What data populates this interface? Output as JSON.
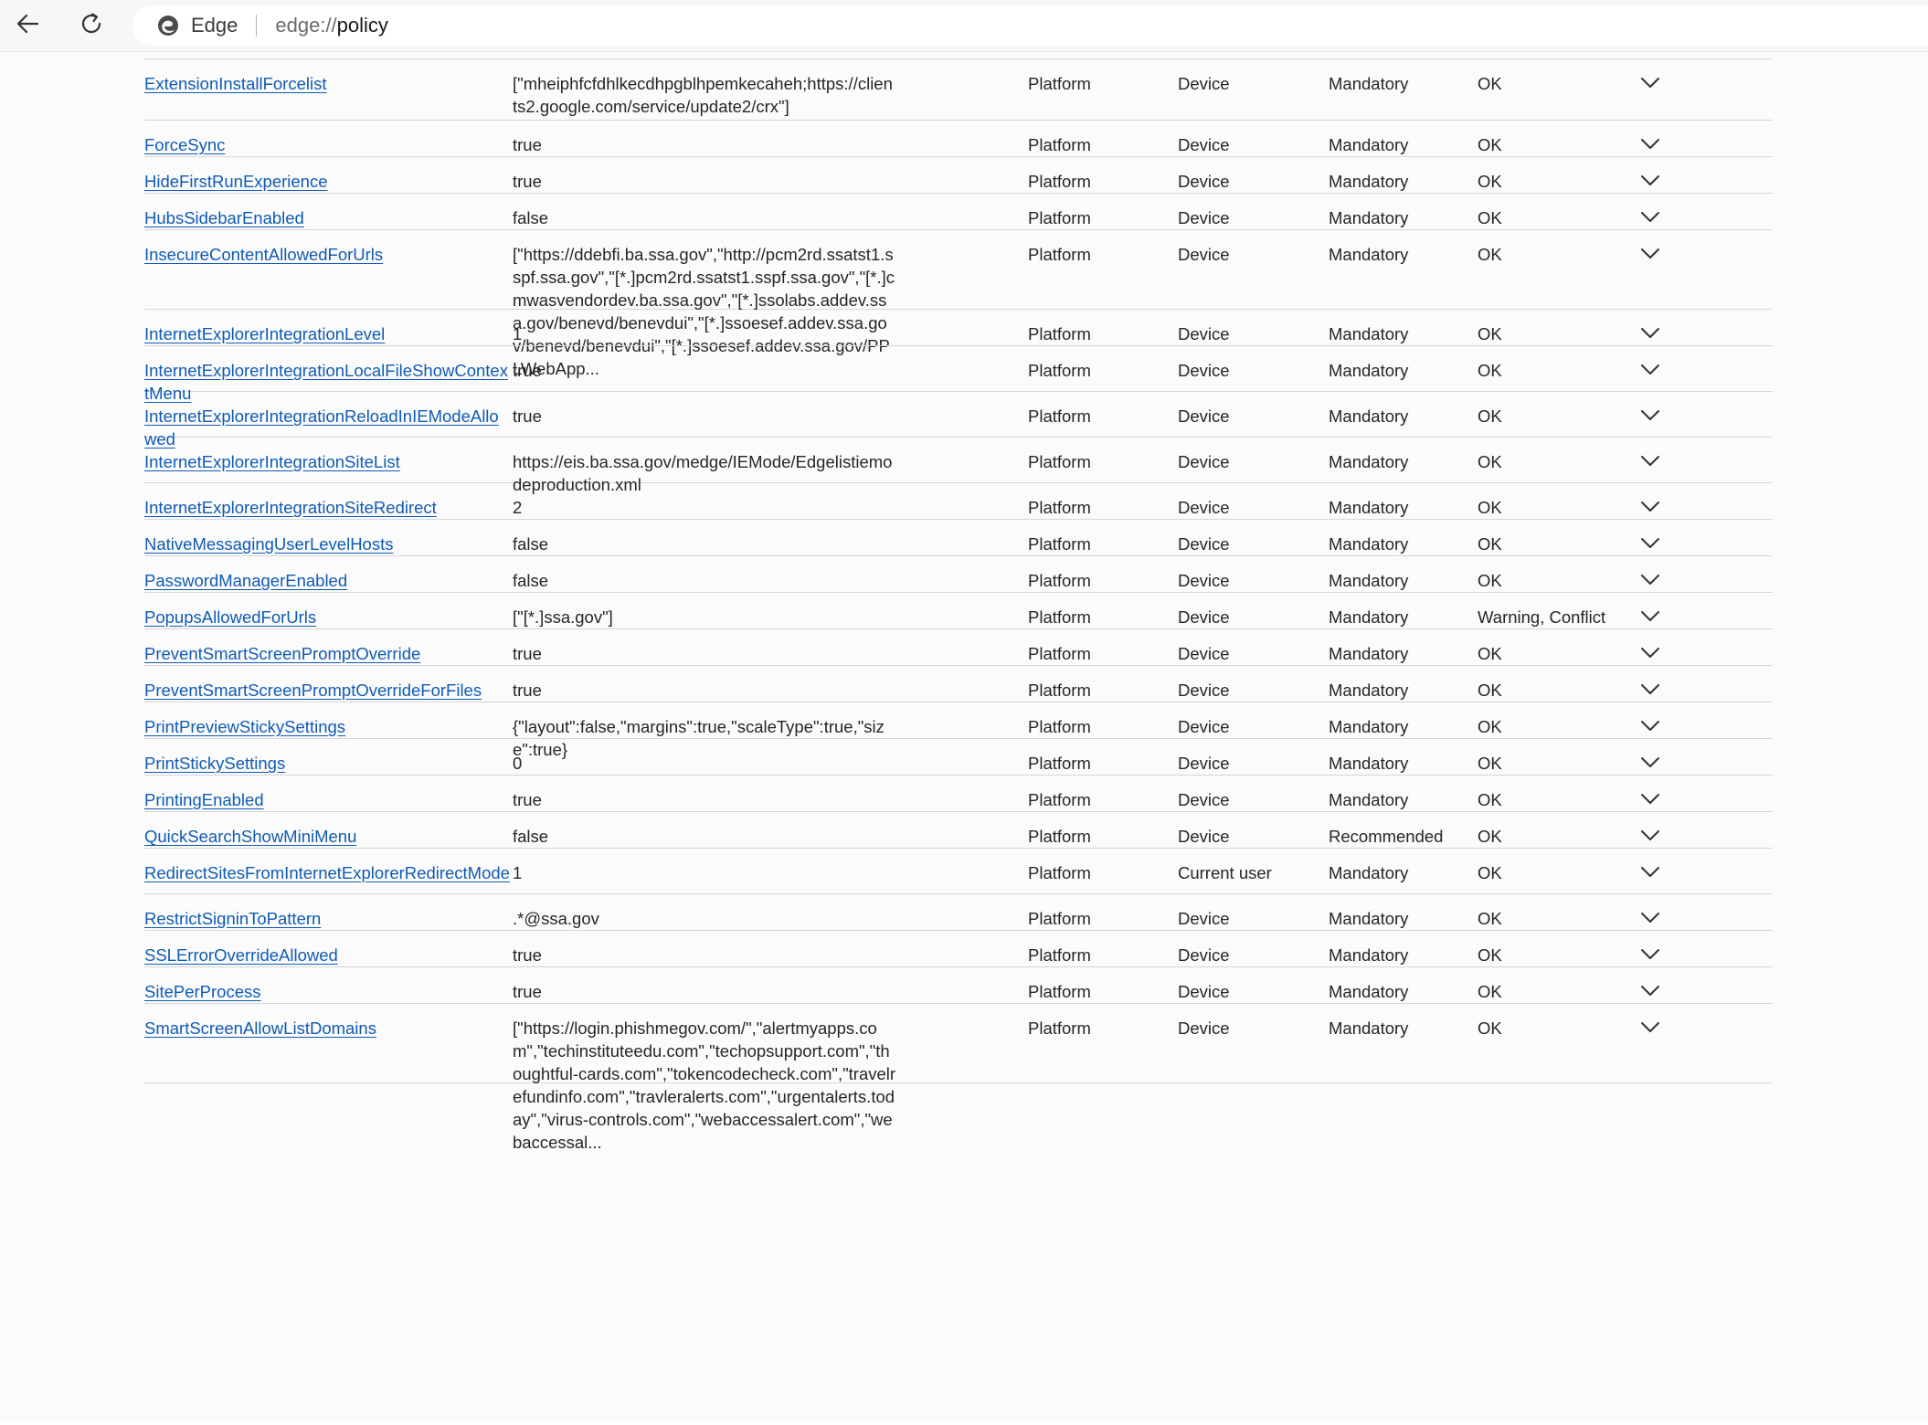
{
  "browser": {
    "site_name": "Edge",
    "url_scheme": "edge://",
    "url_host": "policy",
    "back_icon": "back-arrow-icon",
    "reload_icon": "reload-icon"
  },
  "policies": [
    {
      "name": "ExtensionInstallForcelist",
      "value": "[\"mheiphfcfdhlkecdhpgblhpemkecaheh;https://clients2.google.com/service/update2/crx\"]",
      "source": "Platform",
      "scope": "Device",
      "level": "Mandatory",
      "status": "OK"
    },
    {
      "name": "ForceSync",
      "value": "true",
      "source": "Platform",
      "scope": "Device",
      "level": "Mandatory",
      "status": "OK"
    },
    {
      "name": "HideFirstRunExperience",
      "value": "true",
      "source": "Platform",
      "scope": "Device",
      "level": "Mandatory",
      "status": "OK"
    },
    {
      "name": "HubsSidebarEnabled",
      "value": "false",
      "source": "Platform",
      "scope": "Device",
      "level": "Mandatory",
      "status": "OK"
    },
    {
      "name": "InsecureContentAllowedForUrls",
      "value": "[\"https://ddebfi.ba.ssa.gov\",\"http://pcm2rd.ssatst1.sspf.ssa.gov\",\"[*.]pcm2rd.ssatst1.sspf.ssa.gov\",\"[*.]cmwasvendordev.ba.ssa.gov\",\"[*.]ssolabs.addev.ssa.gov/benevd/benevdui\",\"[*.]ssoesef.addev.ssa.gov/benevd/benevdui\",\"[*.]ssoesef.addev.ssa.gov/PPLWebApp...",
      "source": "Platform",
      "scope": "Device",
      "level": "Mandatory",
      "status": "OK"
    },
    {
      "name": "InternetExplorerIntegrationLevel",
      "value": "1",
      "source": "Platform",
      "scope": "Device",
      "level": "Mandatory",
      "status": "OK"
    },
    {
      "name": "InternetExplorerIntegrationLocalFileShowContextMenu",
      "value": "true",
      "source": "Platform",
      "scope": "Device",
      "level": "Mandatory",
      "status": "OK"
    },
    {
      "name": "InternetExplorerIntegrationReloadInIEModeAllowed",
      "value": "true",
      "source": "Platform",
      "scope": "Device",
      "level": "Mandatory",
      "status": "OK"
    },
    {
      "name": "InternetExplorerIntegrationSiteList",
      "value": "https://eis.ba.ssa.gov/medge/IEMode/Edgelistiemodeproduction.xml",
      "source": "Platform",
      "scope": "Device",
      "level": "Mandatory",
      "status": "OK"
    },
    {
      "name": "InternetExplorerIntegrationSiteRedirect",
      "value": "2",
      "source": "Platform",
      "scope": "Device",
      "level": "Mandatory",
      "status": "OK"
    },
    {
      "name": "NativeMessagingUserLevelHosts",
      "value": "false",
      "source": "Platform",
      "scope": "Device",
      "level": "Mandatory",
      "status": "OK"
    },
    {
      "name": "PasswordManagerEnabled",
      "value": "false",
      "source": "Platform",
      "scope": "Device",
      "level": "Mandatory",
      "status": "OK"
    },
    {
      "name": "PopupsAllowedForUrls",
      "value": "[\"[*.]ssa.gov\"]",
      "source": "Platform",
      "scope": "Device",
      "level": "Mandatory",
      "status": "Warning, Conflict"
    },
    {
      "name": "PreventSmartScreenPromptOverride",
      "value": "true",
      "source": "Platform",
      "scope": "Device",
      "level": "Mandatory",
      "status": "OK"
    },
    {
      "name": "PreventSmartScreenPromptOverrideForFiles",
      "value": "true",
      "source": "Platform",
      "scope": "Device",
      "level": "Mandatory",
      "status": "OK"
    },
    {
      "name": "PrintPreviewStickySettings",
      "value": "{\"layout\":false,\"margins\":true,\"scaleType\":true,\"size\":true}",
      "source": "Platform",
      "scope": "Device",
      "level": "Mandatory",
      "status": "OK"
    },
    {
      "name": "PrintStickySettings",
      "value": "0",
      "source": "Platform",
      "scope": "Device",
      "level": "Mandatory",
      "status": "OK"
    },
    {
      "name": "PrintingEnabled",
      "value": "true",
      "source": "Platform",
      "scope": "Device",
      "level": "Mandatory",
      "status": "OK"
    },
    {
      "name": "QuickSearchShowMiniMenu",
      "value": "false",
      "source": "Platform",
      "scope": "Device",
      "level": "Recommended",
      "status": "OK"
    },
    {
      "name": "RedirectSitesFromInternetExplorerRedirectMode",
      "value": "1",
      "source": "Platform",
      "scope": "Current user",
      "level": "Mandatory",
      "status": "OK"
    },
    {
      "name": "RestrictSigninToPattern",
      "value": ".*@ssa.gov",
      "source": "Platform",
      "scope": "Device",
      "level": "Mandatory",
      "status": "OK"
    },
    {
      "name": "SSLErrorOverrideAllowed",
      "value": "true",
      "source": "Platform",
      "scope": "Device",
      "level": "Mandatory",
      "status": "OK"
    },
    {
      "name": "SitePerProcess",
      "value": "true",
      "source": "Platform",
      "scope": "Device",
      "level": "Mandatory",
      "status": "OK"
    },
    {
      "name": "SmartScreenAllowListDomains",
      "value": "[\"https://login.phishmegov.com/\",\"alertmyapps.com\",\"techinstituteedu.com\",\"techopsupport.com\",\"thoughtful-cards.com\",\"tokencodecheck.com\",\"travelrefundinfo.com\",\"travleralerts.com\",\"urgentalerts.today\",\"virus-controls.com\",\"webaccessalert.com\",\"webaccessal...",
      "source": "Platform",
      "scope": "Device",
      "level": "Mandatory",
      "status": "OK"
    }
  ],
  "expand_icon": "chevron-down-icon"
}
